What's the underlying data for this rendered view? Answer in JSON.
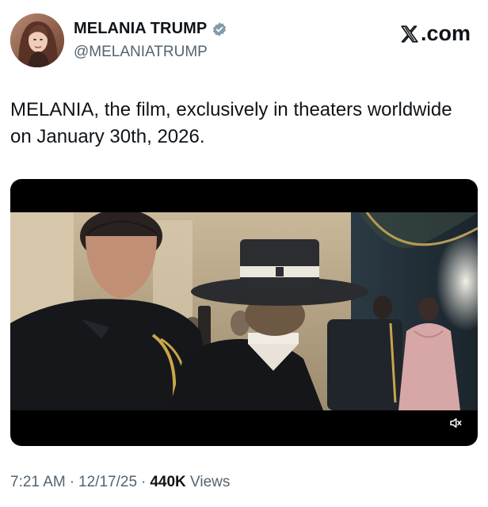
{
  "header": {
    "display_name": "MELANIA TRUMP",
    "handle": "@MELANIATRUMP",
    "brand": ".com",
    "verified_badge_color": "#829aab"
  },
  "tweet": {
    "text": "MELANIA, the film, exclusively in theaters worldwide on January 30th, 2026."
  },
  "media": {
    "type": "video",
    "muted": true,
    "controls": {
      "mute_icon": "speaker-muted-icon"
    }
  },
  "meta": {
    "time": "7:21 AM",
    "date": "12/17/25",
    "views_count": "440K",
    "views_label": "Views",
    "separator": "·"
  },
  "colors": {
    "text_primary": "#0f1419",
    "text_secondary": "#536471",
    "background": "#ffffff"
  }
}
